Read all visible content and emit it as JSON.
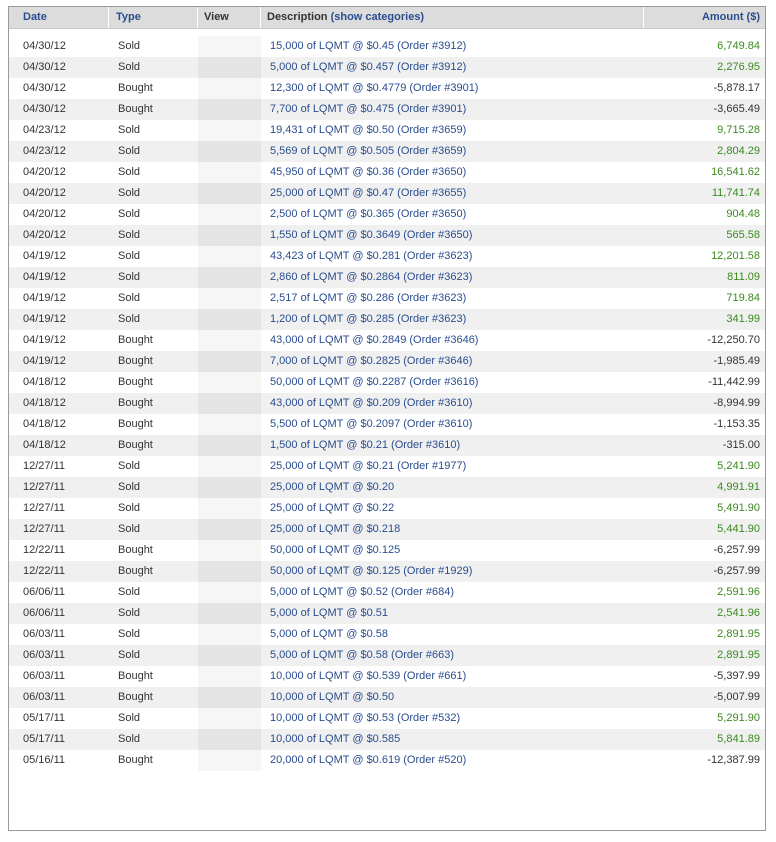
{
  "header": {
    "date": "Date",
    "type": "Type",
    "view": "View",
    "description": "Description",
    "show_categories": "(show categories)",
    "amount": "Amount ($)"
  },
  "colors": {
    "link": "#2a4d8f",
    "positive": "#3a8a1e",
    "negative": "#333333",
    "header_bg": "#dcdcdc"
  },
  "rows": [
    {
      "date": "04/30/12",
      "type": "Sold",
      "desc": "15,000 of LQMT @ $0.45 (Order #3912)",
      "amount": "6,749.84",
      "sign": "pos"
    },
    {
      "date": "04/30/12",
      "type": "Sold",
      "desc": "5,000 of LQMT @ $0.457 (Order #3912)",
      "amount": "2,276.95",
      "sign": "pos"
    },
    {
      "date": "04/30/12",
      "type": "Bought",
      "desc": "12,300 of LQMT @ $0.4779 (Order #3901)",
      "amount": "-5,878.17",
      "sign": "neg"
    },
    {
      "date": "04/30/12",
      "type": "Bought",
      "desc": "7,700 of LQMT @ $0.475 (Order #3901)",
      "amount": "-3,665.49",
      "sign": "neg"
    },
    {
      "date": "04/23/12",
      "type": "Sold",
      "desc": "19,431 of LQMT @ $0.50 (Order #3659)",
      "amount": "9,715.28",
      "sign": "pos"
    },
    {
      "date": "04/23/12",
      "type": "Sold",
      "desc": "5,569 of LQMT @ $0.505 (Order #3659)",
      "amount": "2,804.29",
      "sign": "pos"
    },
    {
      "date": "04/20/12",
      "type": "Sold",
      "desc": "45,950 of LQMT @ $0.36 (Order #3650)",
      "amount": "16,541.62",
      "sign": "pos"
    },
    {
      "date": "04/20/12",
      "type": "Sold",
      "desc": "25,000 of LQMT @ $0.47 (Order #3655)",
      "amount": "11,741.74",
      "sign": "pos"
    },
    {
      "date": "04/20/12",
      "type": "Sold",
      "desc": "2,500 of LQMT @ $0.365 (Order #3650)",
      "amount": "904.48",
      "sign": "pos"
    },
    {
      "date": "04/20/12",
      "type": "Sold",
      "desc": "1,550 of LQMT @ $0.3649 (Order #3650)",
      "amount": "565.58",
      "sign": "pos"
    },
    {
      "date": "04/19/12",
      "type": "Sold",
      "desc": "43,423 of LQMT @ $0.281 (Order #3623)",
      "amount": "12,201.58",
      "sign": "pos"
    },
    {
      "date": "04/19/12",
      "type": "Sold",
      "desc": "2,860 of LQMT @ $0.2864 (Order #3623)",
      "amount": "811.09",
      "sign": "pos"
    },
    {
      "date": "04/19/12",
      "type": "Sold",
      "desc": "2,517 of LQMT @ $0.286 (Order #3623)",
      "amount": "719.84",
      "sign": "pos"
    },
    {
      "date": "04/19/12",
      "type": "Sold",
      "desc": "1,200 of LQMT @ $0.285 (Order #3623)",
      "amount": "341.99",
      "sign": "pos"
    },
    {
      "date": "04/19/12",
      "type": "Bought",
      "desc": "43,000 of LQMT @ $0.2849 (Order #3646)",
      "amount": "-12,250.70",
      "sign": "neg"
    },
    {
      "date": "04/19/12",
      "type": "Bought",
      "desc": "7,000 of LQMT @ $0.2825 (Order #3646)",
      "amount": "-1,985.49",
      "sign": "neg"
    },
    {
      "date": "04/18/12",
      "type": "Bought",
      "desc": "50,000 of LQMT @ $0.2287 (Order #3616)",
      "amount": "-11,442.99",
      "sign": "neg"
    },
    {
      "date": "04/18/12",
      "type": "Bought",
      "desc": "43,000 of LQMT @ $0.209 (Order #3610)",
      "amount": "-8,994.99",
      "sign": "neg"
    },
    {
      "date": "04/18/12",
      "type": "Bought",
      "desc": "5,500 of LQMT @ $0.2097 (Order #3610)",
      "amount": "-1,153.35",
      "sign": "neg"
    },
    {
      "date": "04/18/12",
      "type": "Bought",
      "desc": "1,500 of LQMT @ $0.21 (Order #3610)",
      "amount": "-315.00",
      "sign": "neg"
    },
    {
      "date": "12/27/11",
      "type": "Sold",
      "desc": "25,000 of LQMT @ $0.21 (Order #1977)",
      "amount": "5,241.90",
      "sign": "pos"
    },
    {
      "date": "12/27/11",
      "type": "Sold",
      "desc": "25,000 of LQMT @ $0.20",
      "amount": "4,991.91",
      "sign": "pos"
    },
    {
      "date": "12/27/11",
      "type": "Sold",
      "desc": "25,000 of LQMT @ $0.22",
      "amount": "5,491.90",
      "sign": "pos"
    },
    {
      "date": "12/27/11",
      "type": "Sold",
      "desc": "25,000 of LQMT @ $0.218",
      "amount": "5,441.90",
      "sign": "pos"
    },
    {
      "date": "12/22/11",
      "type": "Bought",
      "desc": "50,000 of LQMT @ $0.125",
      "amount": "-6,257.99",
      "sign": "neg"
    },
    {
      "date": "12/22/11",
      "type": "Bought",
      "desc": "50,000 of LQMT @ $0.125 (Order #1929)",
      "amount": "-6,257.99",
      "sign": "neg"
    },
    {
      "date": "06/06/11",
      "type": "Sold",
      "desc": "5,000 of LQMT @ $0.52 (Order #684)",
      "amount": "2,591.96",
      "sign": "pos"
    },
    {
      "date": "06/06/11",
      "type": "Sold",
      "desc": "5,000 of LQMT @ $0.51",
      "amount": "2,541.96",
      "sign": "pos"
    },
    {
      "date": "06/03/11",
      "type": "Sold",
      "desc": "5,000 of LQMT @ $0.58",
      "amount": "2,891.95",
      "sign": "pos"
    },
    {
      "date": "06/03/11",
      "type": "Sold",
      "desc": "5,000 of LQMT @ $0.58 (Order #663)",
      "amount": "2,891.95",
      "sign": "pos"
    },
    {
      "date": "06/03/11",
      "type": "Bought",
      "desc": "10,000 of LQMT @ $0.539 (Order #661)",
      "amount": "-5,397.99",
      "sign": "neg"
    },
    {
      "date": "06/03/11",
      "type": "Bought",
      "desc": "10,000 of LQMT @ $0.50",
      "amount": "-5,007.99",
      "sign": "neg"
    },
    {
      "date": "05/17/11",
      "type": "Sold",
      "desc": "10,000 of LQMT @ $0.53 (Order #532)",
      "amount": "5,291.90",
      "sign": "pos"
    },
    {
      "date": "05/17/11",
      "type": "Sold",
      "desc": "10,000 of LQMT @ $0.585",
      "amount": "5,841.89",
      "sign": "pos"
    },
    {
      "date": "05/16/11",
      "type": "Bought",
      "desc": "20,000 of LQMT @ $0.619 (Order #520)",
      "amount": "-12,387.99",
      "sign": "neg"
    }
  ]
}
